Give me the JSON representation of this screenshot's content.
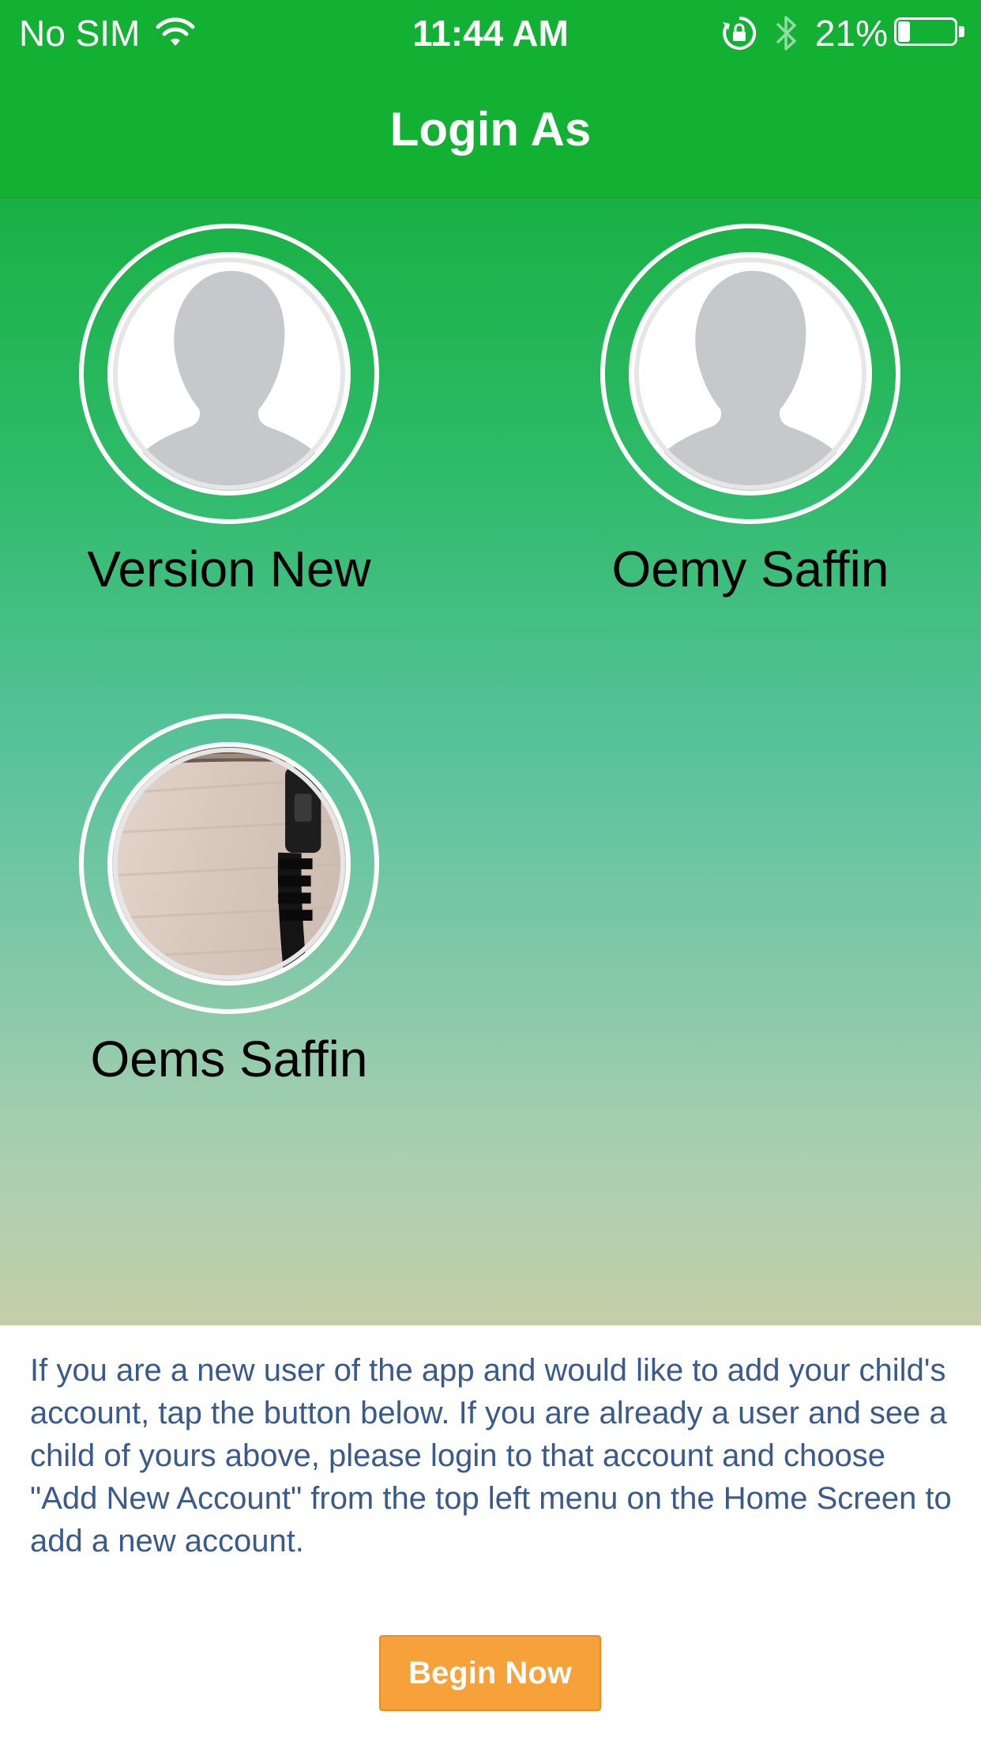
{
  "status_bar": {
    "carrier": "No SIM",
    "time": "11:44 AM",
    "battery_percent": "21%",
    "battery_level": 0.21,
    "icons": [
      "wifi-icon",
      "orientation-lock-icon",
      "bluetooth-icon",
      "battery-icon"
    ]
  },
  "nav": {
    "title": "Login As"
  },
  "profiles": [
    {
      "name": "Version New",
      "avatar": "placeholder-person-icon"
    },
    {
      "name": "Oemy Saffin",
      "avatar": "placeholder-person-icon"
    },
    {
      "name": "Oems Saffin",
      "avatar": "photo"
    }
  ],
  "info": {
    "text": "If you are a new user of the app and would like to add your child's account, tap the button below. If you are already a user and see a child of yours above, please login to that account and choose \"Add New Account\" from the top left menu on the Home Screen to add a new account.",
    "button_label": "Begin Now"
  },
  "colors": {
    "bar_green": "#12b033",
    "button_orange": "#f6a13a",
    "info_text": "#3a5a8c"
  }
}
